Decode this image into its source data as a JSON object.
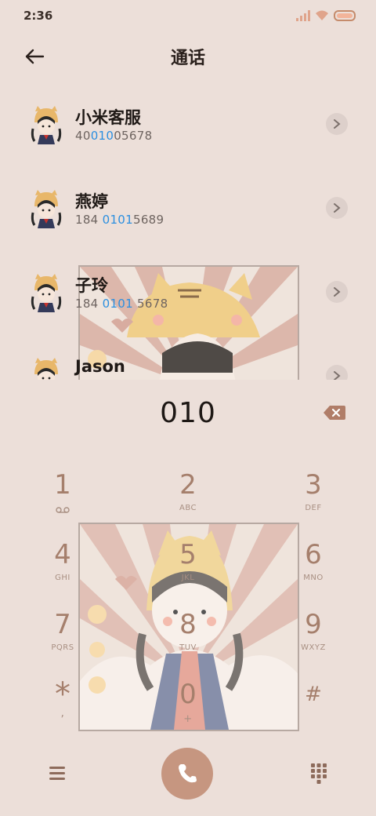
{
  "status": {
    "time": "2:36"
  },
  "header": {
    "title": "通话",
    "back_icon": "arrow-left-icon"
  },
  "contacts": [
    {
      "name": "小米客服",
      "num_pre": "40",
      "num_hl": "010",
      "num_post": "05678"
    },
    {
      "name": "燕婷",
      "num_pre": "184 ",
      "num_hl": "0101",
      "num_post": "5689"
    },
    {
      "name": "子玲",
      "num_pre": "184 ",
      "num_hl": "0101",
      "num_post": " 5678"
    },
    {
      "name": "Jason",
      "num_pre": "",
      "num_hl": "",
      "num_post": ""
    }
  ],
  "dialer": {
    "input": "010"
  },
  "keypad": [
    {
      "digit": "1",
      "letters": ""
    },
    {
      "digit": "2",
      "letters": "ABC"
    },
    {
      "digit": "3",
      "letters": "DEF"
    },
    {
      "digit": "4",
      "letters": "GHI"
    },
    {
      "digit": "5",
      "letters": "JKL"
    },
    {
      "digit": "6",
      "letters": "MNO"
    },
    {
      "digit": "7",
      "letters": "PQRS"
    },
    {
      "digit": "8",
      "letters": "TUV"
    },
    {
      "digit": "9",
      "letters": "WXYZ"
    },
    {
      "digit": "*",
      "letters": ","
    },
    {
      "digit": "0",
      "letters": "+"
    },
    {
      "digit": "#",
      "letters": ""
    }
  ],
  "colors": {
    "accent": "#c69680",
    "highlight": "#2b8fe0",
    "background": "#ecdfd9"
  }
}
